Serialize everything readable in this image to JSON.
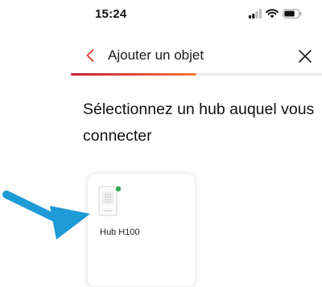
{
  "status_bar": {
    "time": "15:24",
    "icons": [
      "signal-icon",
      "wifi-icon",
      "battery-icon"
    ]
  },
  "header": {
    "title": "Ajouter un objet",
    "back_icon": "chevron-left-icon",
    "close_icon": "close-icon",
    "progress_fraction": 0.5
  },
  "main": {
    "title": "Sélectionnez un hub auquel vous connecter",
    "hubs": [
      {
        "label": "Hub H100",
        "icon": "hub-device-icon",
        "status_color": "#2fa84f"
      }
    ]
  },
  "overlay": {
    "arrow_color": "#1e9bd7"
  },
  "colors": {
    "accent": "#d83a37",
    "arrow": "#1e9bd7"
  }
}
